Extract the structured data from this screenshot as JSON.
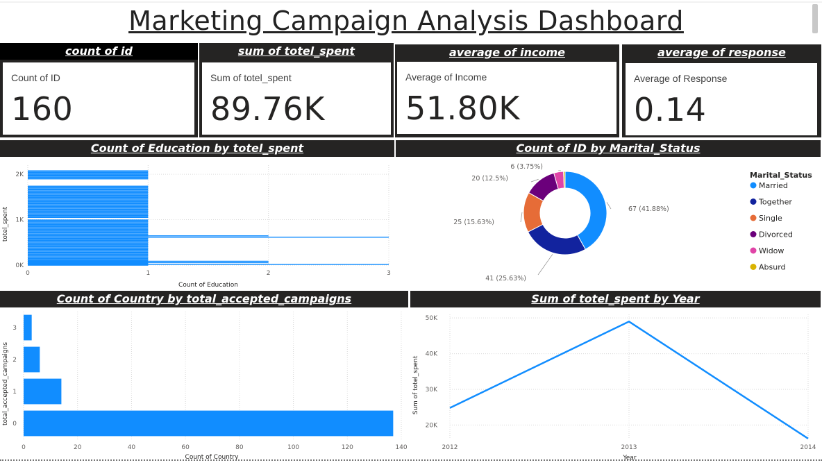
{
  "dashboard_title": "Marketing Campaign Analysis Dashboard",
  "kpis": [
    {
      "header": "count of id",
      "label": "Count of ID",
      "value": "160"
    },
    {
      "header": "sum of totel_spent",
      "label": "Sum of totel_spent",
      "value": "89.76K"
    },
    {
      "header": "average of income",
      "label": "Average of Income",
      "value": "51.80K"
    },
    {
      "header": "average of response",
      "label": "Average of Response",
      "value": "0.14"
    }
  ],
  "panels": {
    "education": {
      "header": "Count of Education by totel_spent"
    },
    "marital": {
      "header": "Count of ID by Marital_Status"
    },
    "country": {
      "header": "Count of Country by total_accepted_campaigns"
    },
    "year": {
      "header": "Sum of totel_spent by Year"
    }
  },
  "chart_data": [
    {
      "id": "education",
      "type": "bar",
      "orientation": "horizontal",
      "xlabel": "Count of Education",
      "ylabel": "totel_spent",
      "x_ticks": [
        "0",
        "1",
        "2",
        "3"
      ],
      "y_ticks": [
        "0K",
        "1K",
        "2K"
      ],
      "xlim": [
        0,
        3
      ],
      "ylim": [
        0,
        2200
      ],
      "grid": true,
      "color": "#118DFF",
      "y_full_bands": [
        [
          0,
          1000
        ],
        [
          1050,
          1750
        ],
        [
          1900,
          2000
        ],
        [
          2000,
          2090
        ]
      ],
      "points": [
        {
          "y": 640,
          "x": 2
        },
        {
          "y": 610,
          "x": 3
        },
        {
          "y": 80,
          "x": 2
        },
        {
          "y": 50,
          "x": 2
        },
        {
          "y": 10,
          "x": 3
        }
      ]
    },
    {
      "id": "marital",
      "type": "pie",
      "donut": true,
      "legend_title": "Marital_Status",
      "legend_position": "right",
      "slices": [
        {
          "label": "Married",
          "value": 67,
          "data_label": "67 (41.88%)",
          "color": "#118DFF"
        },
        {
          "label": "Together",
          "value": 41,
          "data_label": "41 (25.63%)",
          "color": "#12239E"
        },
        {
          "label": "Single",
          "value": 25,
          "data_label": "25 (15.63%)",
          "color": "#E66C37"
        },
        {
          "label": "Divorced",
          "value": 20,
          "data_label": "20 (12.5%)",
          "color": "#6B007B"
        },
        {
          "label": "Widow",
          "value": 6,
          "data_label": "6 (3.75%)",
          "color": "#E044A7"
        },
        {
          "label": "Absurd",
          "value": 1,
          "data_label": "",
          "color": "#D9B300"
        }
      ]
    },
    {
      "id": "country",
      "type": "bar",
      "orientation": "horizontal",
      "xlabel": "Count of Country",
      "ylabel": "total_accepted_campaigns",
      "categories": [
        "3",
        "2",
        "1",
        "0"
      ],
      "values": [
        3,
        6,
        14,
        137
      ],
      "x_ticks": [
        "0",
        "20",
        "40",
        "60",
        "80",
        "100",
        "120",
        "140"
      ],
      "xlim": [
        0,
        140
      ],
      "grid": true,
      "color": "#118DFF"
    },
    {
      "id": "year",
      "type": "line",
      "xlabel": "Year",
      "ylabel": "Sum of totel_spent",
      "x": [
        "2012",
        "2013",
        "2014"
      ],
      "values": [
        24800,
        49000,
        16200
      ],
      "y_ticks": [
        "20K",
        "30K",
        "40K",
        "50K"
      ],
      "ylim": [
        16000,
        51000
      ],
      "grid": true,
      "color": "#118DFF"
    }
  ]
}
